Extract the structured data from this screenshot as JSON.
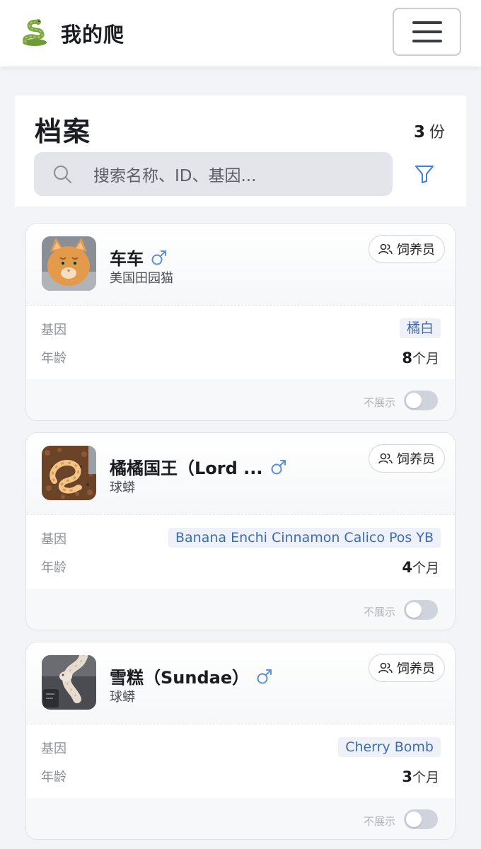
{
  "app": {
    "title": "我的爬",
    "logo_icon": "snake-icon"
  },
  "header": {
    "menu_icon": "hamburger-menu-icon"
  },
  "archive": {
    "title": "档案",
    "count": "3",
    "count_unit": "份",
    "search_placeholder": "搜索名称、ID、基因...",
    "search_icon": "search-icon",
    "filter_icon": "filter-icon"
  },
  "labels": {
    "gene": "基因",
    "age": "年龄",
    "keeper": "饲养员",
    "hide": "不展示"
  },
  "colors": {
    "accent": "#3d6cb5",
    "male": "#5b8fd6"
  },
  "pets": [
    {
      "name": "车车",
      "sex_icon": "male-icon",
      "species": "美国田园猫",
      "gene": "橘白",
      "age_num": "8",
      "age_unit": "个月",
      "avatar": "orange-cat-photo",
      "hidden": false
    },
    {
      "name": "橘橘国王（Lord ...",
      "sex_icon": "male-icon",
      "species": "球蟒",
      "gene": "Banana Enchi Cinnamon Calico Pos YB",
      "age_num": "4",
      "age_unit": "个月",
      "avatar": "ball-python-photo",
      "hidden": false
    },
    {
      "name": "雪糕（Sundae）",
      "sex_icon": "male-icon",
      "species": "球蟒",
      "gene": "Cherry Bomb",
      "age_num": "3",
      "age_unit": "个月",
      "avatar": "white-python-photo",
      "hidden": false
    }
  ]
}
